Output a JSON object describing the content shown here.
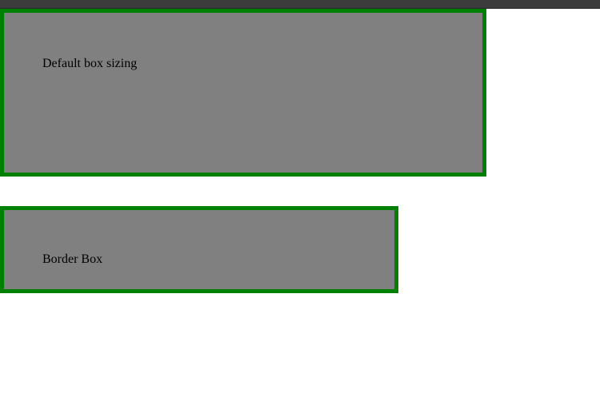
{
  "boxes": {
    "default": {
      "label": "Default box sizing"
    },
    "border": {
      "label": "Border Box"
    }
  },
  "colors": {
    "box_background": "#808080",
    "box_border": "#008000",
    "top_bar": "#3c3c3c",
    "page_background": "#ffffff",
    "text": "#000000"
  }
}
